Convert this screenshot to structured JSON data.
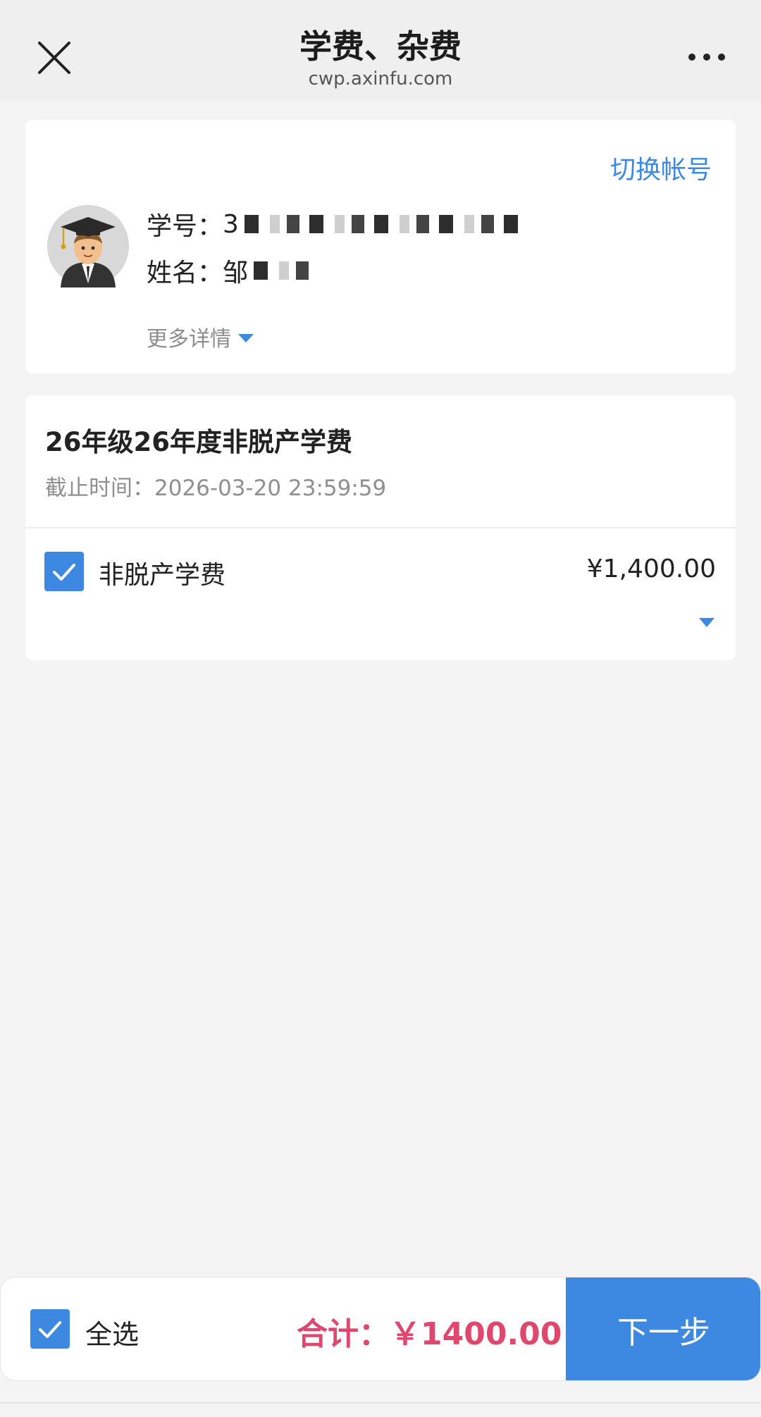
{
  "header": {
    "title": "学费、杂费",
    "subtitle": "cwp.axinfu.com",
    "close_icon": "close-icon",
    "more_icon": "more-icon"
  },
  "account": {
    "switch_label": "切换帐号",
    "student_id_label": "学号：",
    "student_id_visible": "3",
    "name_label": "姓名：",
    "name_visible": "邹",
    "more_details": "更多详情",
    "avatar_icon": "graduate-avatar-icon"
  },
  "fee": {
    "title": "26年级26年度非脱产学费",
    "deadline": "截止时间：2026-03-20 23:59:59",
    "items": [
      {
        "name": "非脱产学费",
        "price": "¥1,400.00",
        "checked": true
      }
    ]
  },
  "footer": {
    "select_all": "全选",
    "total": "合计：￥1400.00",
    "next": "下一步"
  },
  "colors": {
    "accent": "#3d88e0",
    "total": "#e0476e",
    "background": "#f4f4f4"
  }
}
